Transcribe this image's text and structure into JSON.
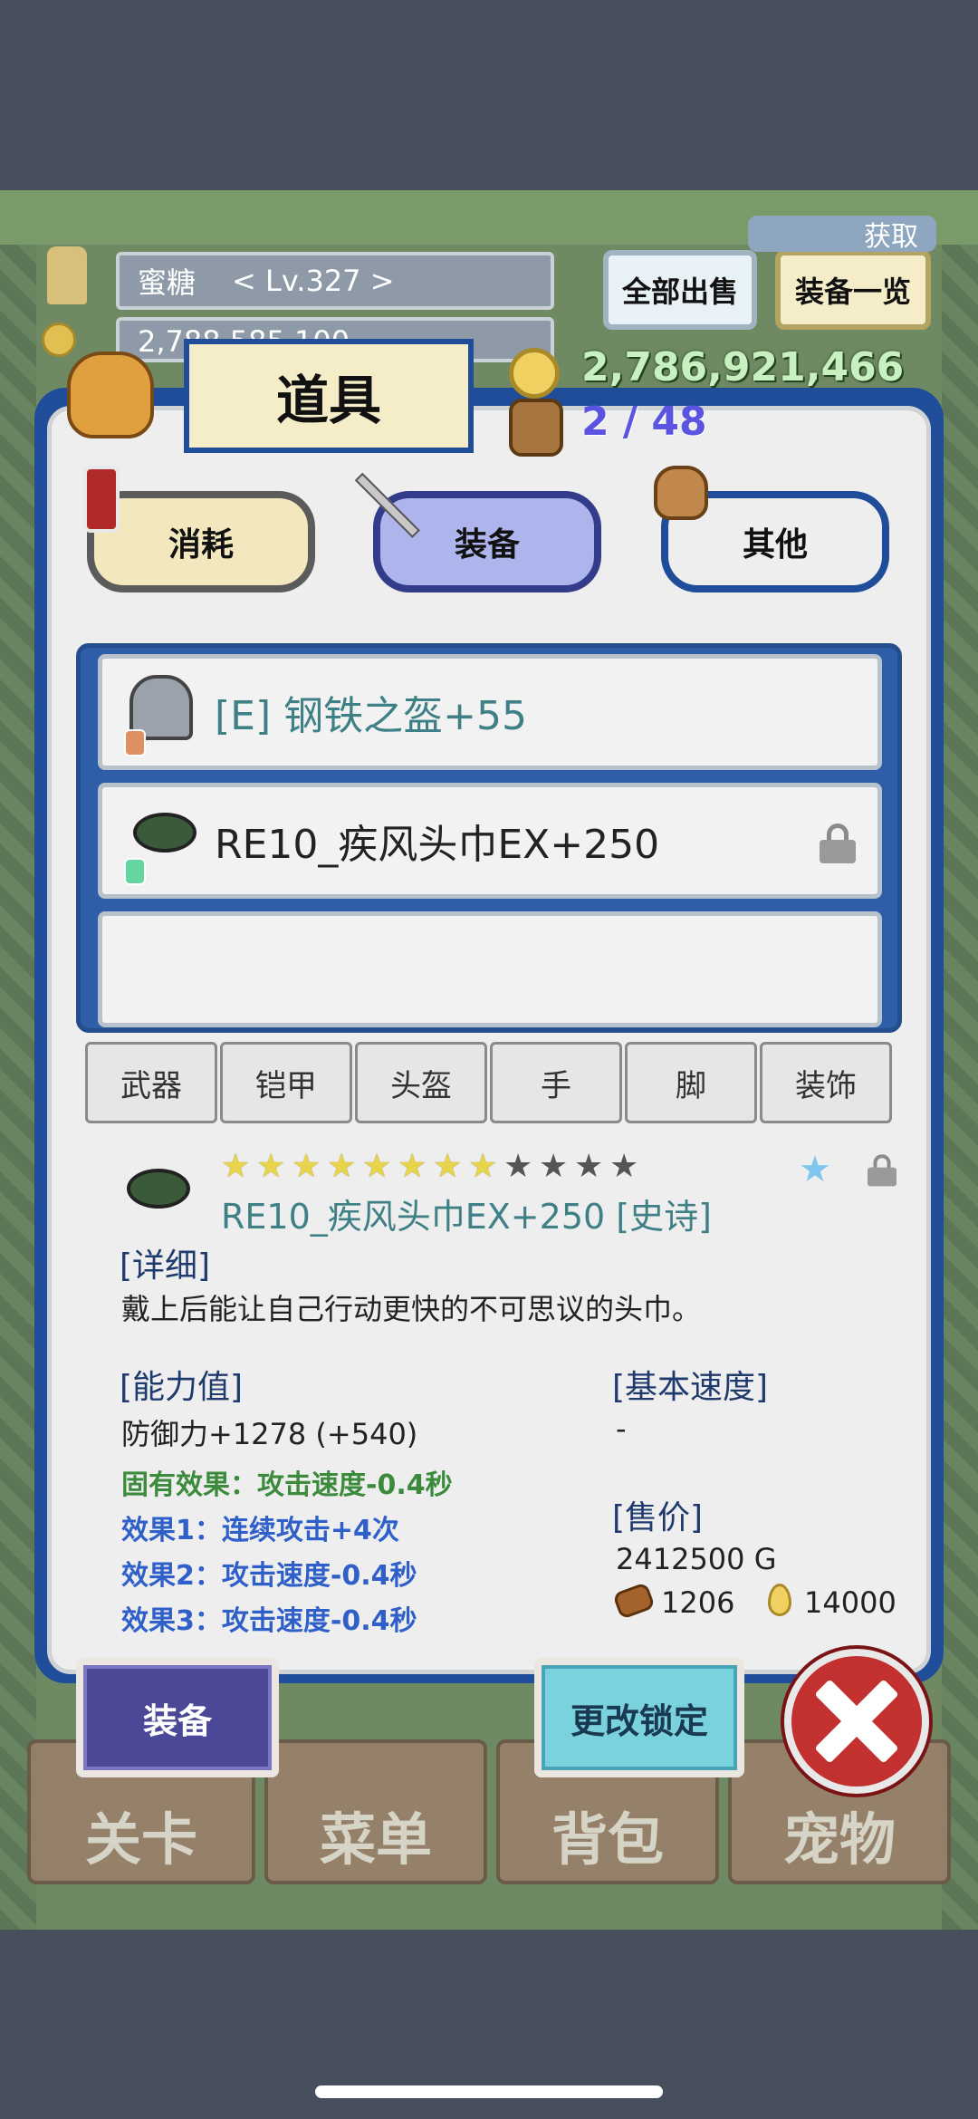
{
  "header": {
    "player_name": "蜜糖",
    "player_level": "< Lv.327 >",
    "gold_partial": "2,788,585,100",
    "sell_all_button": "全部出售",
    "equip_list_button": "装备一览",
    "corner_label": "获取"
  },
  "panel": {
    "title": "道具",
    "gold": "2,786,921,466",
    "bag_count": "2 / 48",
    "categories": [
      "消耗",
      "装备",
      "其他"
    ],
    "selected_category": "装备"
  },
  "items": [
    {
      "name": "[E] 钢铁之盔+55",
      "equipped": true,
      "locked": false
    },
    {
      "name": "RE10_疾风头巾EX+250",
      "equipped": false,
      "locked": true
    },
    {
      "name": "",
      "equipped": false,
      "locked": false
    }
  ],
  "filters": [
    "武器",
    "铠甲",
    "头盔",
    "手",
    "脚",
    "装饰"
  ],
  "detail": {
    "stars_filled": 8,
    "stars_total": 12,
    "item_title": "RE10_疾风头巾EX+250 [史诗]",
    "detail_header": "[详细]",
    "description": "戴上后能让自己行动更快的不可思议的头巾。",
    "stats_header": "[能力值]",
    "defense": "防御力+1278 (+540)",
    "effects": [
      {
        "text": "固有效果：攻击速度-0.4秒",
        "color": "#3c8a3c"
      },
      {
        "text": "效果1：连续攻击+4次",
        "color": "#2f5fc8"
      },
      {
        "text": "效果2：攻击速度-0.4秒",
        "color": "#2f5fc8"
      },
      {
        "text": "效果3：攻击速度-0.4秒",
        "color": "#2f5fc8"
      }
    ],
    "speed_header": "[基本速度]",
    "speed_value": "-",
    "price_header": "[售价]",
    "price": "2412500 G",
    "material_count": "1206",
    "droplet_count": "14000"
  },
  "actions": {
    "equip_button": "装备",
    "lock_button": "更改锁定"
  },
  "nav": [
    "关卡",
    "菜单",
    "背包",
    "宠物"
  ],
  "colors": {
    "panel_blue": "#1f4d99",
    "gold_text": "#c8f0c0",
    "bag_text": "#5a54e0",
    "item_teal": "#3f7f86"
  }
}
